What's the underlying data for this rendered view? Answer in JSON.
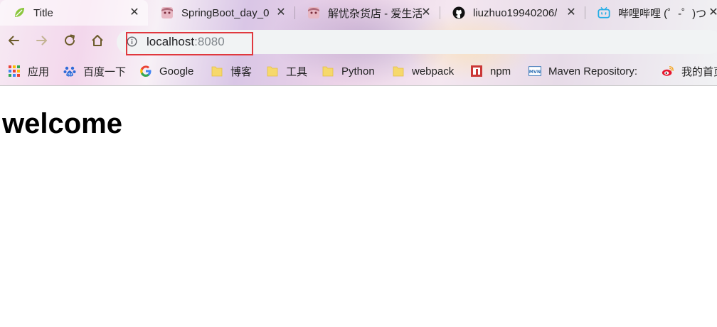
{
  "tabs": [
    {
      "title": "Title",
      "favicon": "spring-leaf-icon",
      "active": true
    },
    {
      "title": "SpringBoot_day_0",
      "favicon": "anime-avatar-icon",
      "active": false
    },
    {
      "title": "解忧杂货店 - 爱生活",
      "favicon": "anime-avatar-icon",
      "active": false
    },
    {
      "title": "liuzhuo19940206/",
      "favicon": "github-icon",
      "active": false
    },
    {
      "title": "哔哩哔哩 (゜-゜)つ",
      "favicon": "bilibili-icon",
      "active": false
    }
  ],
  "tab_close_glyph": "✕",
  "omnibox": {
    "host": "localhost",
    "port": ":8080"
  },
  "bookmarks": [
    {
      "label": "应用",
      "icon": "apps-grid-icon"
    },
    {
      "label": "百度一下",
      "icon": "baidu-paw-icon"
    },
    {
      "label": "Google",
      "icon": "google-icon"
    },
    {
      "label": "博客",
      "icon": "folder-icon"
    },
    {
      "label": "工具",
      "icon": "folder-icon"
    },
    {
      "label": "Python",
      "icon": "folder-icon"
    },
    {
      "label": "webpack",
      "icon": "folder-icon"
    },
    {
      "label": "npm",
      "icon": "npm-icon"
    },
    {
      "label": "Maven Repository:",
      "icon": "mvn-icon"
    },
    {
      "label": "我的首页",
      "icon": "weibo-icon"
    }
  ],
  "page": {
    "heading": "welcome"
  },
  "colors": {
    "highlight_box": "#e0383e",
    "folder_yellow": "#f6d86b",
    "nav_icon": "#6b5a2a"
  }
}
